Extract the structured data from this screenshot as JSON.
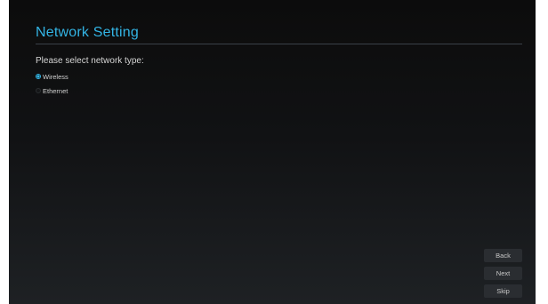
{
  "header": {
    "title": "Network Setting"
  },
  "form": {
    "prompt": "Please select network type:",
    "options": [
      {
        "label": "Wireless",
        "checked": true
      },
      {
        "label": "Ethernet",
        "checked": false
      }
    ]
  },
  "footer": {
    "back_label": "Back",
    "next_label": "Next",
    "skip_label": "Skip"
  },
  "colors": {
    "accent": "#33b5e5",
    "background": "#111214",
    "button": "#2a2d31"
  }
}
